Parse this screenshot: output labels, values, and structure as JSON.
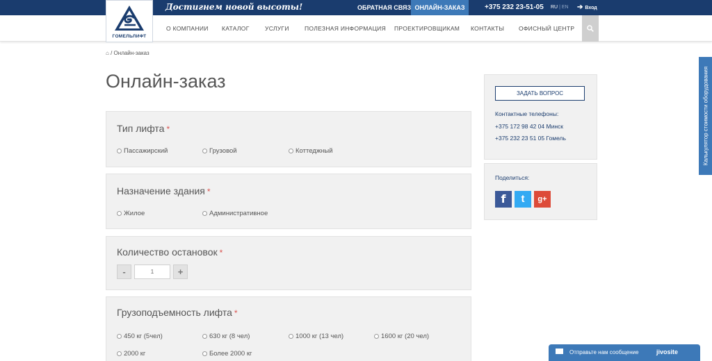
{
  "topbar": {
    "slogan": "Достигнем новой высоты!",
    "feedback": "Обратная связь",
    "online_order": "Онлайн-заказ",
    "phone": "+375 232 23-51-05",
    "lang_ru": "RU",
    "lang_sep": "|",
    "lang_en": "EN",
    "login": "Вход"
  },
  "logo": {
    "text": "ГОМЕЛЬЛИФТ"
  },
  "nav": {
    "items": [
      "О компании",
      "Каталог",
      "Услуги",
      "Полезная информация",
      "Проектировщикам",
      "Контакты",
      "Офисный центр"
    ]
  },
  "breadcrumb": {
    "separator": "/",
    "current": "Онлайн-заказ"
  },
  "page_title": "Онлайн-заказ",
  "form": {
    "required_mark": "*",
    "lift_type": {
      "title": "Тип лифта",
      "options": [
        "Пассажирский",
        "Грузовой",
        "Коттеджный"
      ]
    },
    "building": {
      "title": "Назначение здания",
      "options": [
        "Жилое",
        "Административное"
      ]
    },
    "stops": {
      "title": "Количество остановок",
      "minus": "-",
      "value": "1",
      "plus": "+"
    },
    "capacity": {
      "title": "Грузоподъемность лифта",
      "options": [
        "450 кг (5чел)",
        "630 кг (8 чел)",
        "1000 кг (13 чел)",
        "1600 кг (20 чел)",
        "2000 кг",
        "Более 2000 кг"
      ]
    }
  },
  "sidebar": {
    "ask_button": "Задать вопрос",
    "contacts_label": "Контактные телефоны:",
    "phones": [
      "+375 172 98 42 04 Минск",
      "+375 232 23 51 05 Гомель"
    ],
    "share_label": "Поделиться:",
    "social": {
      "facebook": "f",
      "twitter": "t",
      "googleplus": "g+"
    }
  },
  "calculator_tab": "Калькулятор стоимости оборудования",
  "chat": {
    "message": "Отправьте нам сообщение",
    "brand": "jivosite"
  },
  "colors": {
    "primary": "#1a3c6e",
    "accent": "#3d79b8",
    "required": "#d9534f",
    "panel_bg": "#f1f1f1"
  }
}
